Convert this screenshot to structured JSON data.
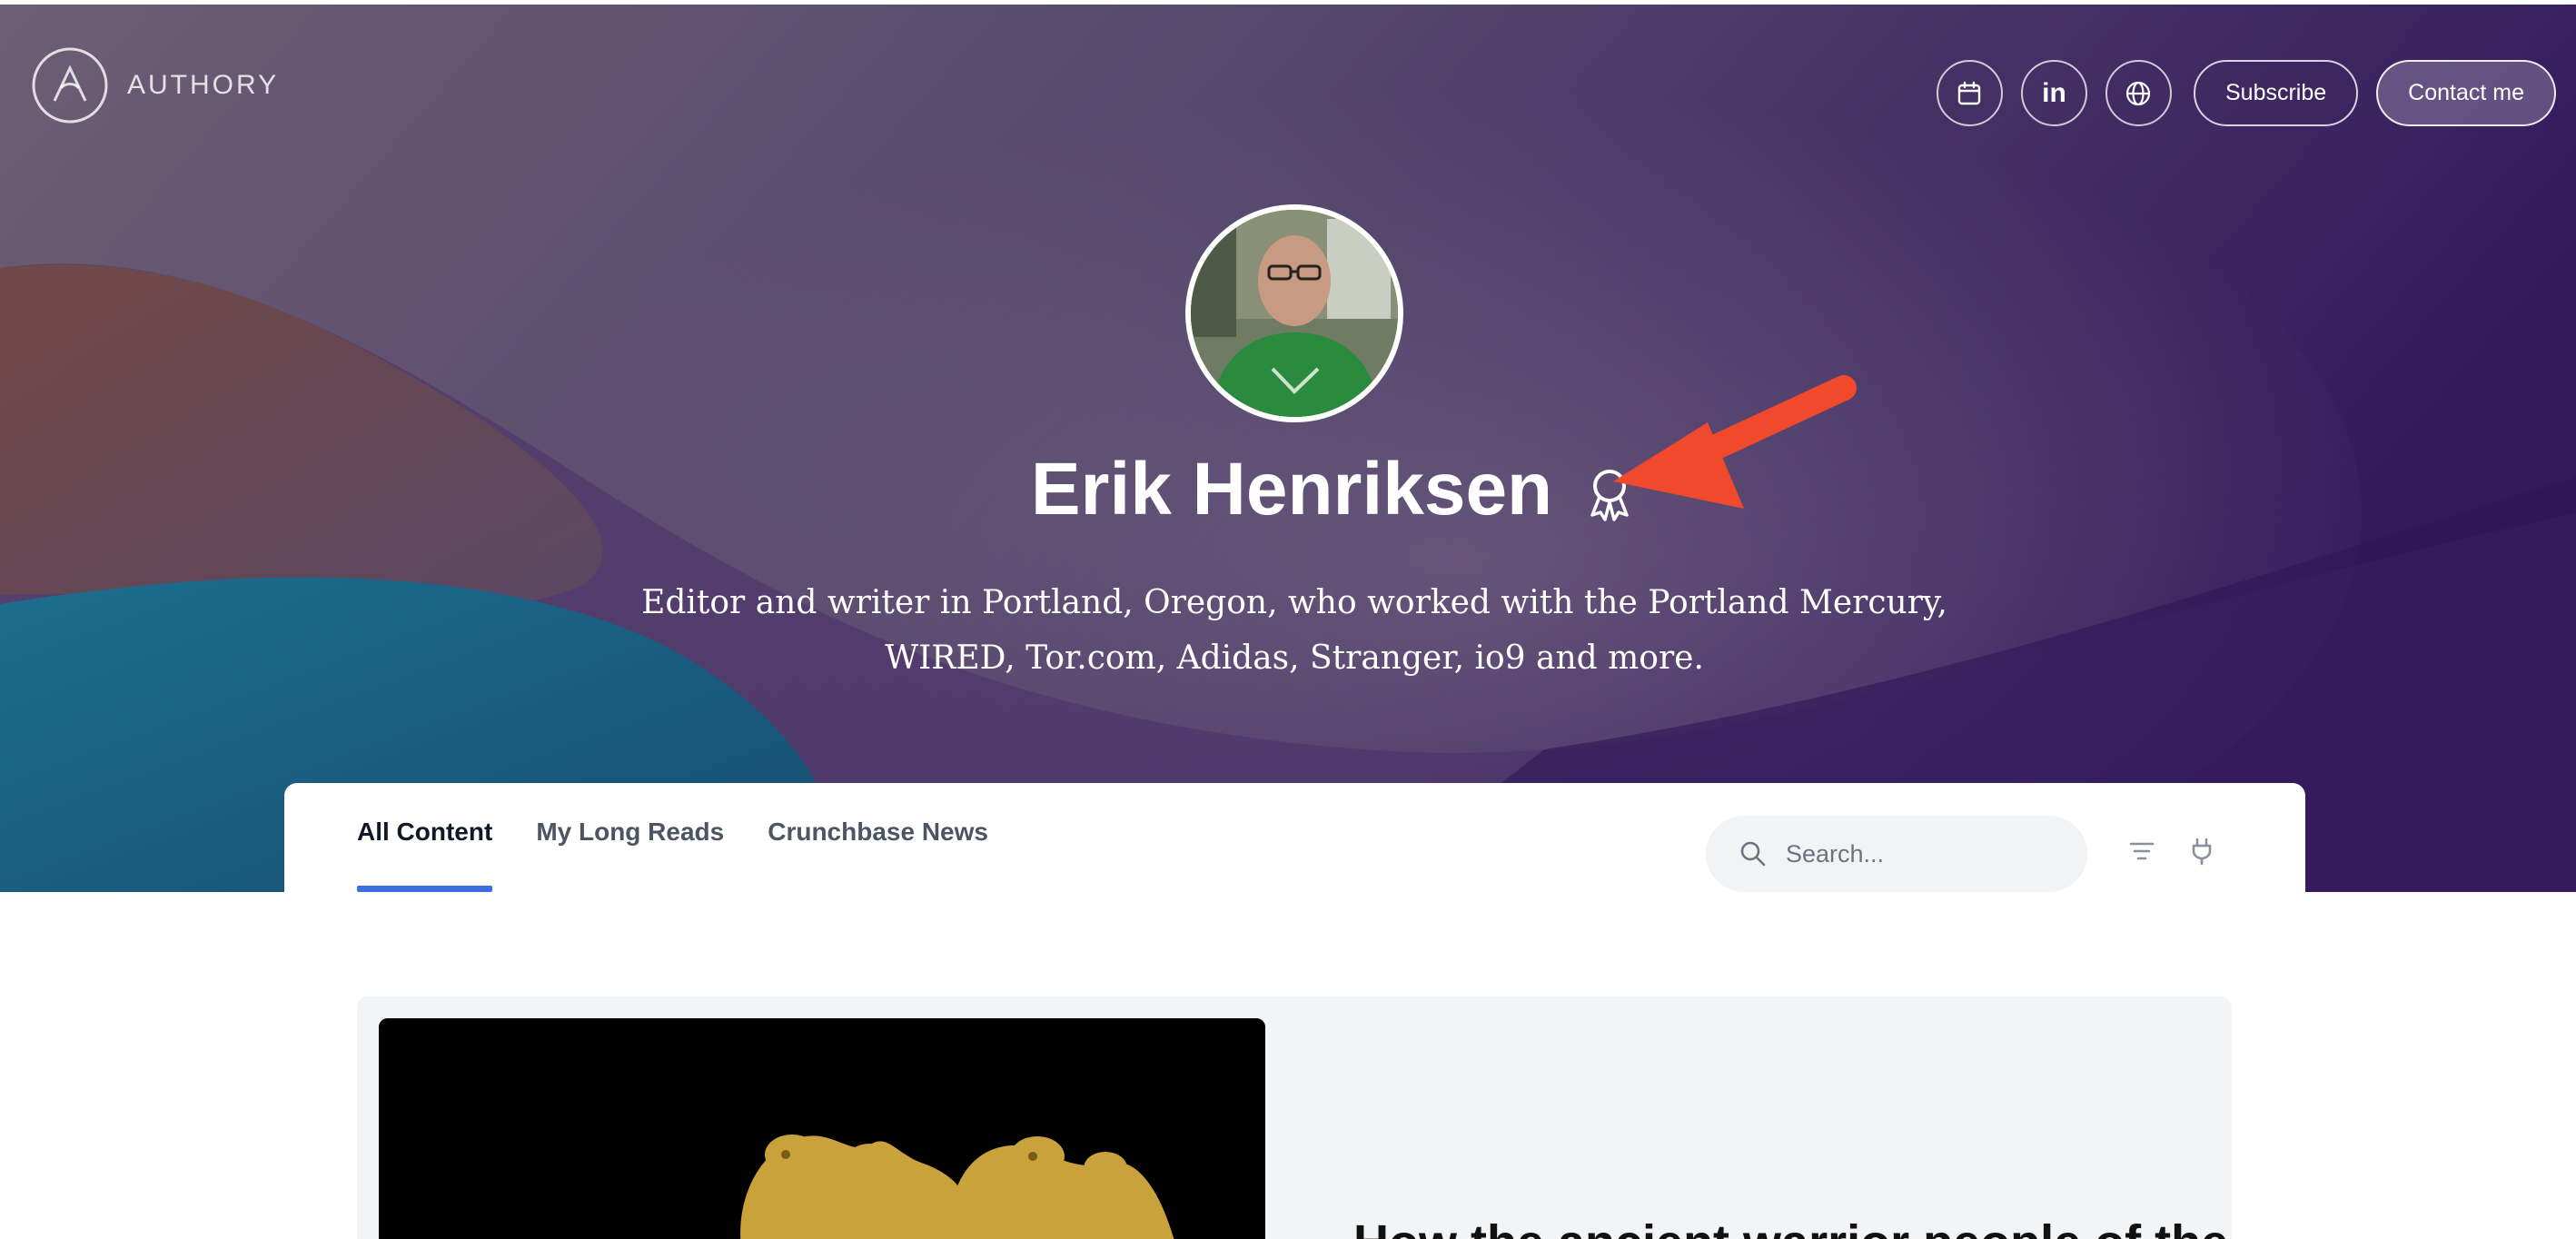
{
  "brand": {
    "name": "AUTHORY"
  },
  "header": {
    "icon_buttons": [
      {
        "icon": "calendar-icon"
      },
      {
        "icon": "linkedin-icon",
        "label": "in"
      },
      {
        "icon": "globe-icon"
      }
    ],
    "subscribe_label": "Subscribe",
    "contact_label": "Contact me"
  },
  "profile": {
    "name": "Erik Henriksen",
    "bio": "Editor and writer in Portland, Oregon, who worked with the Portland Mercury, WIRED, Tor.com, Adidas, Stranger, io9 and more."
  },
  "tabs": [
    {
      "label": "All Content",
      "active": true
    },
    {
      "label": "My Long Reads",
      "active": false
    },
    {
      "label": "Crunchbase News",
      "active": false
    }
  ],
  "search": {
    "placeholder": "Search..."
  },
  "article": {
    "title": "How the ancient warrior people of the"
  },
  "colors": {
    "accent": "#3b6fe0",
    "arrow": "#f0492b",
    "hero_purple": "#3a1f63"
  }
}
